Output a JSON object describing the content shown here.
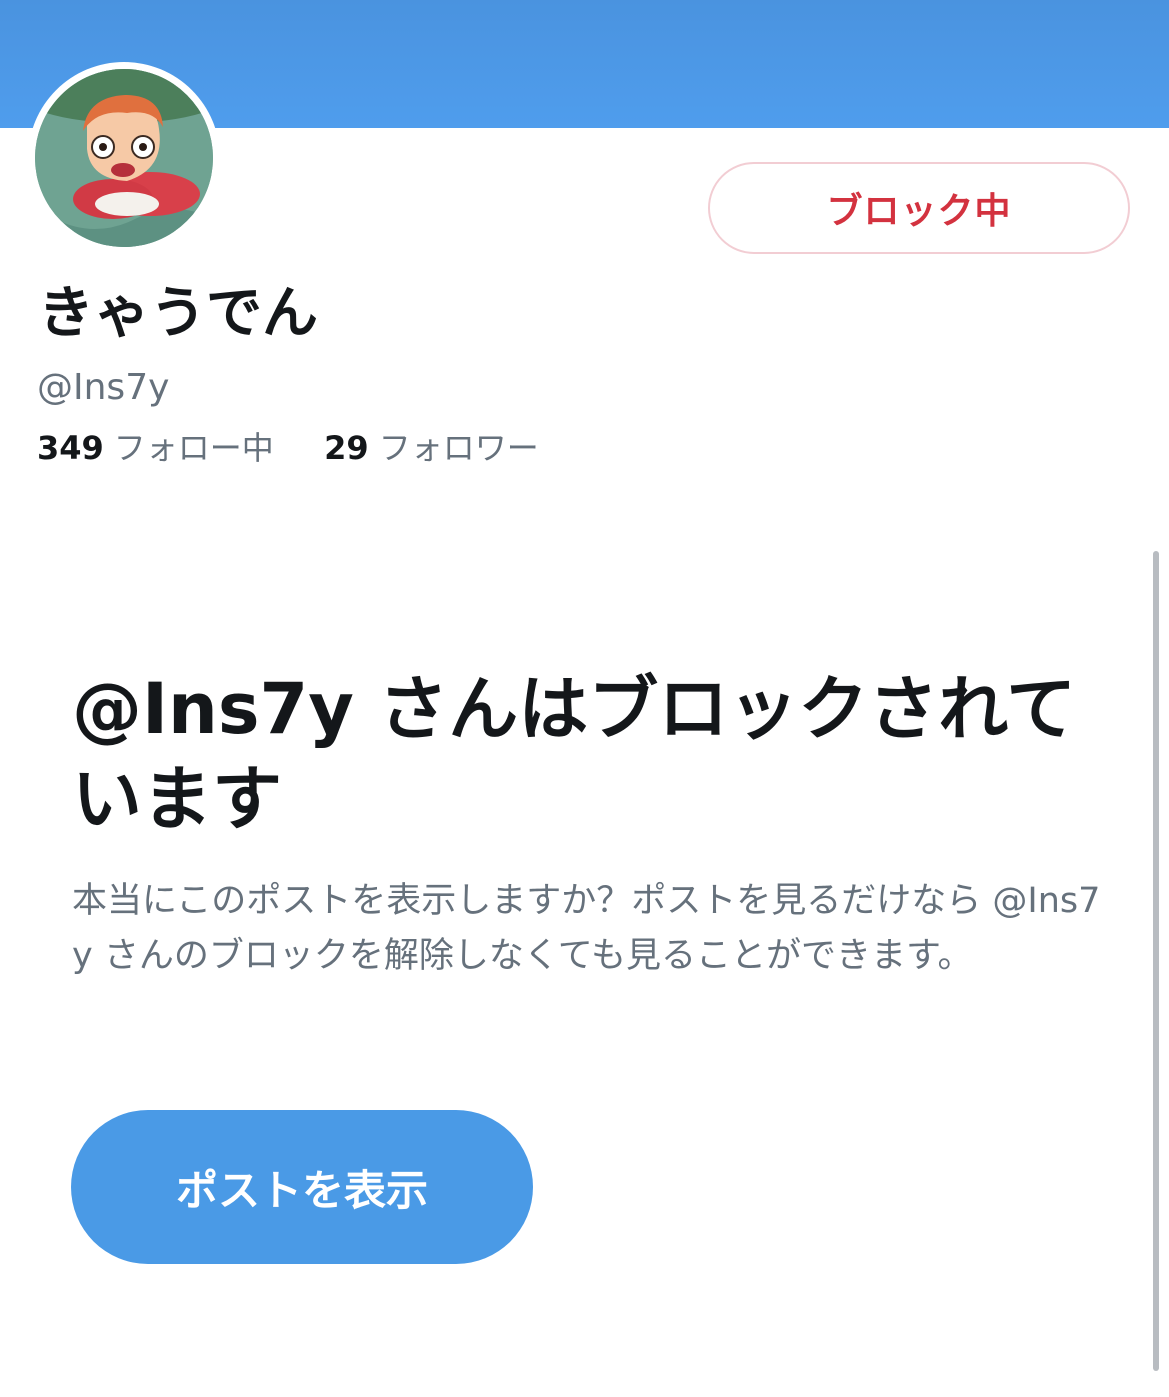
{
  "profile": {
    "display_name": "きゃうでん",
    "handle": "@Ins7y",
    "block_button_label": "ブロック中",
    "following_count": "349",
    "following_label": "フォロー中",
    "followers_count": "29",
    "followers_label": "フォロワー"
  },
  "notice": {
    "title": "@Ins7y さんはブロックされています",
    "body": "本当にこのポストを表示しますか？ポストを見るだけなら @Ins7y さんのブロックを解除しなくても見ることができます。",
    "view_button_label": "ポストを表示"
  },
  "colors": {
    "banner": "#4a93df",
    "block_red": "#d3323f",
    "button_blue": "#4a9ae6",
    "text_primary": "#14171a",
    "text_secondary": "#66717c"
  },
  "icons": {
    "avatar": "avatar-image"
  }
}
